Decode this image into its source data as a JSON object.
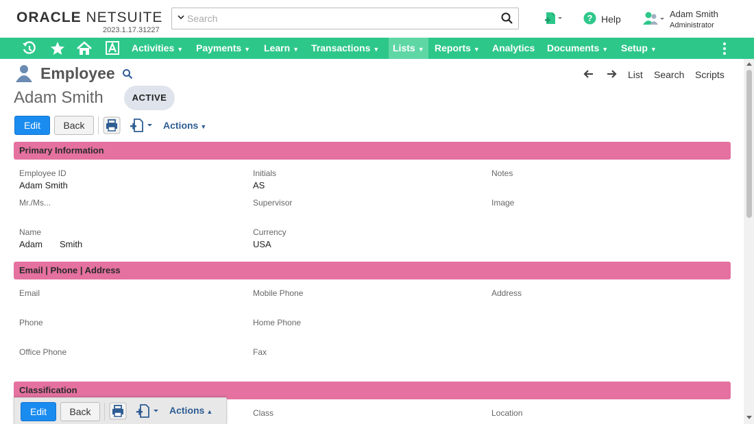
{
  "header": {
    "logo_oracle": "ORACLE",
    "logo_netsuite": "NETSUITE",
    "version": "2023.1.17.31227",
    "search_placeholder": "Search",
    "help_label": "Help",
    "user_name": "Adam Smith",
    "user_role": "Administrator"
  },
  "nav": {
    "items": [
      {
        "label": "Activities",
        "caret": "▼"
      },
      {
        "label": "Payments",
        "caret": "▼"
      },
      {
        "label": "Learn",
        "caret": "▼"
      },
      {
        "label": "Transactions",
        "caret": "▼"
      },
      {
        "label": "Lists",
        "caret": "▼"
      },
      {
        "label": "Reports",
        "caret": "▼"
      },
      {
        "label": "Analytics",
        "caret": ""
      },
      {
        "label": "Documents",
        "caret": "▼"
      },
      {
        "label": "Setup",
        "caret": "▼"
      }
    ],
    "active": "Lists"
  },
  "page": {
    "title": "Employee",
    "links": {
      "list": "List",
      "search": "Search",
      "scripts": "Scripts"
    },
    "record_name": "Adam Smith",
    "status": "ACTIVE"
  },
  "toolbar": {
    "edit": "Edit",
    "back": "Back",
    "actions": "Actions",
    "actions_caret_down": "▼",
    "actions_caret_up": "▲"
  },
  "sections": {
    "primary": {
      "title": "Primary Information",
      "employee_id_label": "Employee ID",
      "employee_id_value": "Adam Smith",
      "initials_label": "Initials",
      "initials_value": "AS",
      "notes_label": "Notes",
      "salutation_label": "Mr./Ms...",
      "supervisor_label": "Supervisor",
      "image_label": "Image",
      "name_label": "Name",
      "first_name": "Adam",
      "last_name": "Smith",
      "currency_label": "Currency",
      "currency_value": "USA"
    },
    "contact": {
      "title": "Email | Phone | Address",
      "email_label": "Email",
      "mobile_label": "Mobile Phone",
      "address_label": "Address",
      "phone_label": "Phone",
      "home_phone_label": "Home Phone",
      "office_phone_label": "Office Phone",
      "fax_label": "Fax"
    },
    "classification": {
      "title": "Classification",
      "class_label": "Class",
      "location_label": "Location"
    }
  },
  "colors": {
    "nav_bg": "#2ec78a",
    "nav_active": "#5fd7a5",
    "section_bar": "#e4719f",
    "edit_button": "#1a8cf0",
    "actions_text": "#2e5c93"
  }
}
